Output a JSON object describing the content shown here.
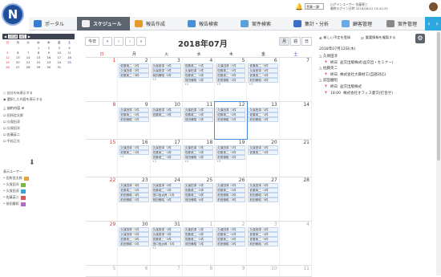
{
  "app": {
    "logo": "N",
    "tabs": [
      {
        "label": "ポータル",
        "color": "#3a7bd5",
        "icon": "portal-icon"
      },
      {
        "label": "スケジュール",
        "color": "#f0f0f0",
        "icon": "schedule-icon",
        "active": true
      },
      {
        "label": "報告作成",
        "color": "#e89a2a",
        "icon": "report-create-icon"
      },
      {
        "label": "報告検索",
        "color": "#4a90d9",
        "icon": "report-search-icon"
      },
      {
        "label": "案件検索",
        "color": "#5aa0e0",
        "icon": "case-search-icon"
      },
      {
        "label": "集計・分析",
        "color": "#3b6fc7",
        "icon": "analytics-icon"
      },
      {
        "label": "顧客管理",
        "color": "#6aa8e8",
        "icon": "customer-icon"
      },
      {
        "label": "案件管理",
        "color": "#888",
        "icon": "case-manage-icon"
      }
    ]
  },
  "user": {
    "select": "営業一課",
    "line1": "ログインユーザー 佐藤恵三",
    "line2": "最終ログイン日時 2018/08/12 15:41:33"
  },
  "minical": {
    "year": "2018",
    "month": "8月",
    "head": [
      "日",
      "月",
      "火",
      "水",
      "木",
      "金",
      "土"
    ],
    "days": [
      "",
      "",
      "",
      "1",
      "2",
      "3",
      "4",
      "5",
      "6",
      "7",
      "8",
      "9",
      "10",
      "11",
      "12",
      "13",
      "14",
      "15",
      "16",
      "17",
      "18",
      "19",
      "20",
      "21",
      "22",
      "23",
      "24",
      "25",
      "26",
      "27",
      "28",
      "29",
      "30",
      "31",
      ""
    ]
  },
  "side": {
    "opt1": "自分のみ表示する",
    "opt2": "選択した内容を表示する",
    "group_label": "協約内容",
    "members": [
      "田所信太郎",
      "久保田淳",
      "久保田洋",
      "佐藤英二",
      "平松正光"
    ],
    "legend_title": "表示ユーザー",
    "legend": [
      {
        "name": "田所信太郎",
        "color": "#e8a33a"
      },
      {
        "name": "久保田洋",
        "color": "#7ab648"
      },
      {
        "name": "久保田淳",
        "color": "#3aa0d8"
      },
      {
        "name": "佐藤英二",
        "color": "#d35a5a"
      },
      {
        "name": "前田雅昭",
        "color": "#b06ac0"
      }
    ]
  },
  "main": {
    "today": "今日",
    "title": "2018年07月",
    "views": [
      "月",
      "週",
      "日"
    ],
    "weekdays": [
      "日",
      "月",
      "火",
      "水",
      "木",
      "金",
      "土"
    ],
    "weeks": [
      {
        "days": [
          "1",
          "2",
          "3",
          "4",
          "5",
          "6",
          "7"
        ],
        "events": [
          [],
          [
            "佐藤英二 ?2件",
            "久保田淳 ?2件",
            "佐藤英二 ?3件"
          ],
          [
            "久保田淳 ?1件",
            "久保田淳 ?1件",
            "前田雅昭 ?2件"
          ],
          [
            "佐藤英二 ?1件",
            "久保田淳 ?1件",
            "佐藤英二 ?1件",
            "前田雅昭 ?1件"
          ],
          [
            "久保田淳 ?1件",
            "佐藤英二 ?1件",
            "佐藤英二 ?2件",
            "前田雅昭 ?2件"
          ],
          [
            "佐藤英二 ?2件",
            "久保田淳 ?1件",
            "佐藤英二 ?1件",
            "前田雅昭 ?2件"
          ],
          []
        ],
        "more": [
          "",
          "",
          "+2",
          "+2",
          "+2",
          "+2",
          ""
        ]
      },
      {
        "days": [
          "8",
          "9",
          "10",
          "11",
          "12",
          "13",
          "14"
        ],
        "events": [
          [],
          [
            "久保田淳 ?1件",
            "佐藤英二 ?1件",
            "前田雅昭 ?1件"
          ],
          [
            "久保田淳 ?1件",
            "佐藤英二 ?1件"
          ],
          [
            "久保田淳 ?1件",
            "佐藤英二 ?1件",
            "前田雅昭 ?1件"
          ],
          [
            "久保田淳 ?2件",
            "佐藤英二 ?1件",
            "前田雅昭 ?1件"
          ],
          [
            "久保田淳 ?1件",
            "佐藤英二 ?1件",
            "前田雅昭 ?1件"
          ],
          []
        ],
        "more": [
          "",
          "",
          "",
          "",
          "",
          "",
          ""
        ]
      },
      {
        "days": [
          "15",
          "16",
          "17",
          "18",
          "19",
          "20",
          "21"
        ],
        "events": [
          [],
          [
            "久保田淳 ?1件",
            "佐藤英二 ?1件"
          ],
          [
            "久保田淳 ?1件",
            "佐藤英二 ?1件",
            "佐藤英二 ?1件"
          ],
          [
            "久保田淳 ?1件",
            "佐藤英二 ?1件",
            "前田雅昭 ?1件"
          ],
          [
            "久保田淳 ?1件",
            "佐藤英二 ?2件",
            "前田雅昭 ?2件"
          ],
          [
            "久保田淳 ?1件",
            "佐藤英二 ?1件"
          ],
          []
        ],
        "more": [
          "",
          "+2",
          "+2",
          "+2",
          "+2",
          "",
          ""
        ]
      },
      {
        "days": [
          "22",
          "23",
          "24",
          "25",
          "26",
          "27",
          "28"
        ],
        "events": [
          [],
          [
            "久保田淳 ?3件",
            "佐藤英二 ?1件",
            "前田雅昭 ?3件",
            "前田雅昭 ?1件"
          ],
          [
            "久保田淳 ?2件",
            "佐藤英二 ?1件",
            "田口信太郎 ?1件",
            "前田雅昭 ?1件"
          ],
          [
            "久保田淳 ?2件",
            "佐藤英二 ?2件",
            "佐藤英二 ?3件",
            "前田雅昭 ?4件"
          ],
          [
            "久保田淳 ?2件",
            "佐藤英二 ?1件",
            "前田雅昭 ?2件",
            "前田雅昭 ?3件"
          ],
          [
            "久保田淳 ?2件",
            "佐藤英二 ?1件",
            "前田雅昭 ?1件",
            "前田雅昭 ?3件"
          ],
          []
        ],
        "more": [
          "",
          "",
          "",
          "",
          "",
          "",
          ""
        ]
      },
      {
        "days": [
          "29",
          "30",
          "31",
          "1",
          "2",
          "3",
          "4"
        ],
        "events": [
          [],
          [
            "久保田淳 ?1件",
            "久保田淳 ?1件",
            "佐藤英二 ?2件",
            "前田雅昭 ?1件"
          ],
          [
            "久保田淳 ?1件",
            "久保田淳 ?1件",
            "佐藤英二 ?2件",
            "田口信太郎 ?1件"
          ],
          [
            "久保田淳 ?1件",
            "佐藤英二 ?1件",
            "佐藤英二 ?2件",
            "前田雅昭 ?1件"
          ],
          [
            "久保田淳 ?2件",
            "佐藤英二 ?1件",
            "佐藤英二 ?2件",
            "前田雅昭 ?2件"
          ],
          [
            "久保田淳 ?1件",
            "佐藤英二 ?1件",
            "佐藤英二 ?2件",
            "前田雅昭 ?1件"
          ],
          []
        ],
        "more": [
          "",
          "",
          "+2",
          "",
          "",
          "",
          ""
        ]
      },
      {
        "days": [
          "5",
          "6",
          "7",
          "8",
          "9",
          "10",
          "11"
        ],
        "events": [
          [],
          [],
          [],
          [],
          [],
          [],
          []
        ],
        "more": [
          "",
          "",
          "",
          "",
          "",
          "",
          ""
        ]
      }
    ]
  },
  "right": {
    "btn_new": "新しい予定を登録",
    "btn_copy": "重要情報を複製する",
    "date": "2018年07月12日(木)",
    "entries": [
      {
        "name": "久保田淳",
        "time": "終日",
        "text": "益交出版株式(益交出・セミナー)"
      },
      {
        "name": "佐藤英二",
        "time": "終日",
        "text": "株式会社大興材工(自部対応)"
      },
      {
        "name": "前田雅昭",
        "time": "終日",
        "text": "益交出版株式"
      },
      {
        "name": "",
        "time": "18:00",
        "text": "株式会社オフィス菱交(打合せ)"
      }
    ]
  }
}
